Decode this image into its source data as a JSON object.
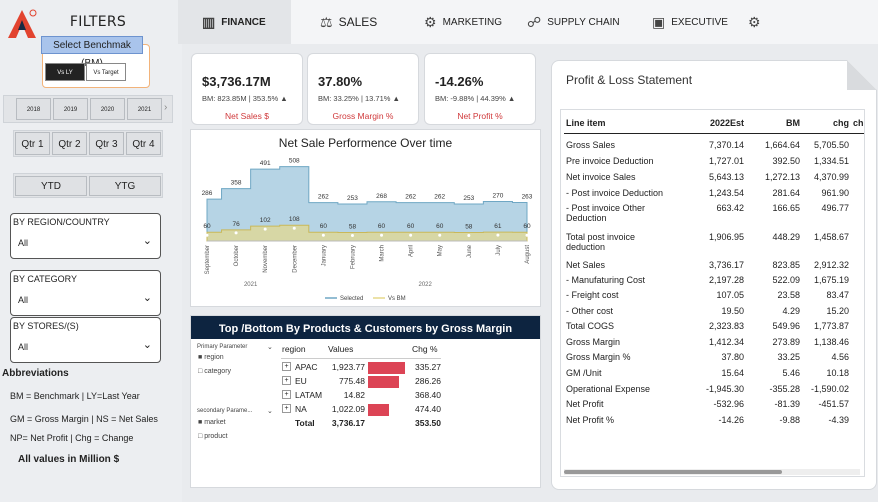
{
  "sidebar": {
    "title": "FILTERS",
    "benchmark_label": "Select Benchmak (BM)",
    "toggle_on": "Vs LY",
    "toggle_off": "Vs Target",
    "years": [
      "2018",
      "2019",
      "2020",
      "2021"
    ],
    "quarters": [
      "Qtr 1",
      "Qtr 2",
      "Qtr 3",
      "Qtr 4"
    ],
    "periods": [
      "YTD",
      "YTG"
    ],
    "slicers": [
      {
        "title": "BY REGION/COUNTRY",
        "value": "All"
      },
      {
        "title": "BY CATEGORY",
        "value": "All"
      },
      {
        "title": "BY STORES/(S)",
        "value": "All"
      }
    ],
    "abbr_title": "Abbreviations",
    "abbr_lines": [
      "BM = Benchmark | LY=Last Year",
      "GM = Gross Margin | NS = Net Sales",
      "NP= Net Profit | Chg = Change"
    ],
    "all_values": "All values in Million $"
  },
  "nav": {
    "tabs": [
      {
        "label": "FINANCE",
        "icon": "chart-icon"
      },
      {
        "label": "SALES",
        "icon": "scale-icon"
      },
      {
        "label": "MARKETING",
        "icon": "gears-icon"
      },
      {
        "label": "SUPPLY CHAIN",
        "icon": "network-icon"
      },
      {
        "label": "EXECUTIVE",
        "icon": "briefcase-icon"
      }
    ]
  },
  "cards": [
    {
      "value": "$3,736.17M",
      "sub": "BM: 823.85M | 353.5% ▲",
      "name": "Net Sales $"
    },
    {
      "value": "37.80%",
      "sub": "BM: 33.25% | 13.71% ▲",
      "name": "Gross Margin %"
    },
    {
      "value": "-14.26%",
      "sub": "BM: -9.88% | 44.39% ▲",
      "name": "Net Profit %"
    }
  ],
  "chart_data": {
    "type": "area",
    "title": "Net Sale  Performence Over time",
    "categories": [
      "September",
      "October",
      "November",
      "December",
      "January",
      "February",
      "March",
      "April",
      "May",
      "June",
      "July",
      "August"
    ],
    "year_labels": [
      "2021",
      "2022"
    ],
    "series": [
      {
        "name": "Selected",
        "values": [
          286,
          358,
          491,
          508,
          262,
          253,
          268,
          262,
          262,
          253,
          270,
          263
        ],
        "color": "#a9cde0"
      },
      {
        "name": "Vs BM",
        "values": [
          60,
          76,
          102,
          108,
          60,
          58,
          60,
          60,
          60,
          58,
          61,
          60
        ],
        "color": "#e6d98a"
      }
    ],
    "legend": "bottom"
  },
  "top_bottom": {
    "title": "Top /Bottom By Products & Customers by Gross Margin",
    "primary_label": "Primary Parameter",
    "primary_options": [
      {
        "label": "region",
        "checked": true
      },
      {
        "label": "category",
        "checked": false
      }
    ],
    "secondary_label": "secondary Parame...",
    "secondary_options": [
      {
        "label": "market",
        "checked": true
      },
      {
        "label": "product",
        "checked": false
      }
    ],
    "columns": [
      "region",
      "Values",
      "Chg %"
    ],
    "rows": [
      {
        "name": "APAC",
        "value": "1,923.77",
        "chg": "335.27",
        "bar": 335.27
      },
      {
        "name": "EU",
        "value": "775.48",
        "chg": "286.26",
        "bar": 286.26
      },
      {
        "name": "LATAM",
        "value": "14.82",
        "chg": "368.40",
        "bar": 0
      },
      {
        "name": "NA",
        "value": "1,022.09",
        "chg": "474.40",
        "bar": 190
      }
    ],
    "total": {
      "name": "Total",
      "value": "3,736.17",
      "chg": "353.50"
    }
  },
  "pl": {
    "title": "Profit & Loss Statement",
    "columns": [
      "Line item",
      "2022Est",
      "BM",
      "chg",
      "ch"
    ],
    "rows": [
      [
        "Gross Sales",
        "7,370.14",
        "1,664.64",
        "5,705.50"
      ],
      [
        "Pre invoice Deduction",
        "1,727.01",
        "392.50",
        "1,334.51"
      ],
      [
        "Net invoice Sales",
        "5,643.13",
        "1,272.13",
        "4,370.99"
      ],
      [
        "- Post invoice Deduction",
        "1,243.54",
        "281.64",
        "961.90"
      ],
      [
        "- Post invoice Other Deduction",
        "663.42",
        "166.65",
        "496.77"
      ],
      [
        "Total post invoice deduction",
        "1,906.95",
        "448.29",
        "1,458.67"
      ],
      [
        "Net Sales",
        "3,736.17",
        "823.85",
        "2,912.32"
      ],
      [
        "- Manufaturing Cost",
        "2,197.28",
        "522.09",
        "1,675.19"
      ],
      [
        "- Freight cost",
        "107.05",
        "23.58",
        "83.47"
      ],
      [
        "- Other cost",
        "19.50",
        "4.29",
        "15.20"
      ],
      [
        "Total COGS",
        "2,323.83",
        "549.96",
        "1,773.87"
      ],
      [
        "Gross Margin",
        "1,412.34",
        "273.89",
        "1,138.46"
      ],
      [
        "Gross Margin %",
        "37.80",
        "33.25",
        "4.56"
      ],
      [
        "GM /Unit",
        "15.64",
        "5.46",
        "10.18"
      ],
      [
        "Operational Expense",
        "-1,945.30",
        "-355.28",
        "-1,590.02"
      ],
      [
        "Net Profit",
        "-532.96",
        "-81.39",
        "-451.57"
      ],
      [
        "Net Profit %",
        "-14.26",
        "-9.88",
        "-4.39"
      ]
    ]
  }
}
